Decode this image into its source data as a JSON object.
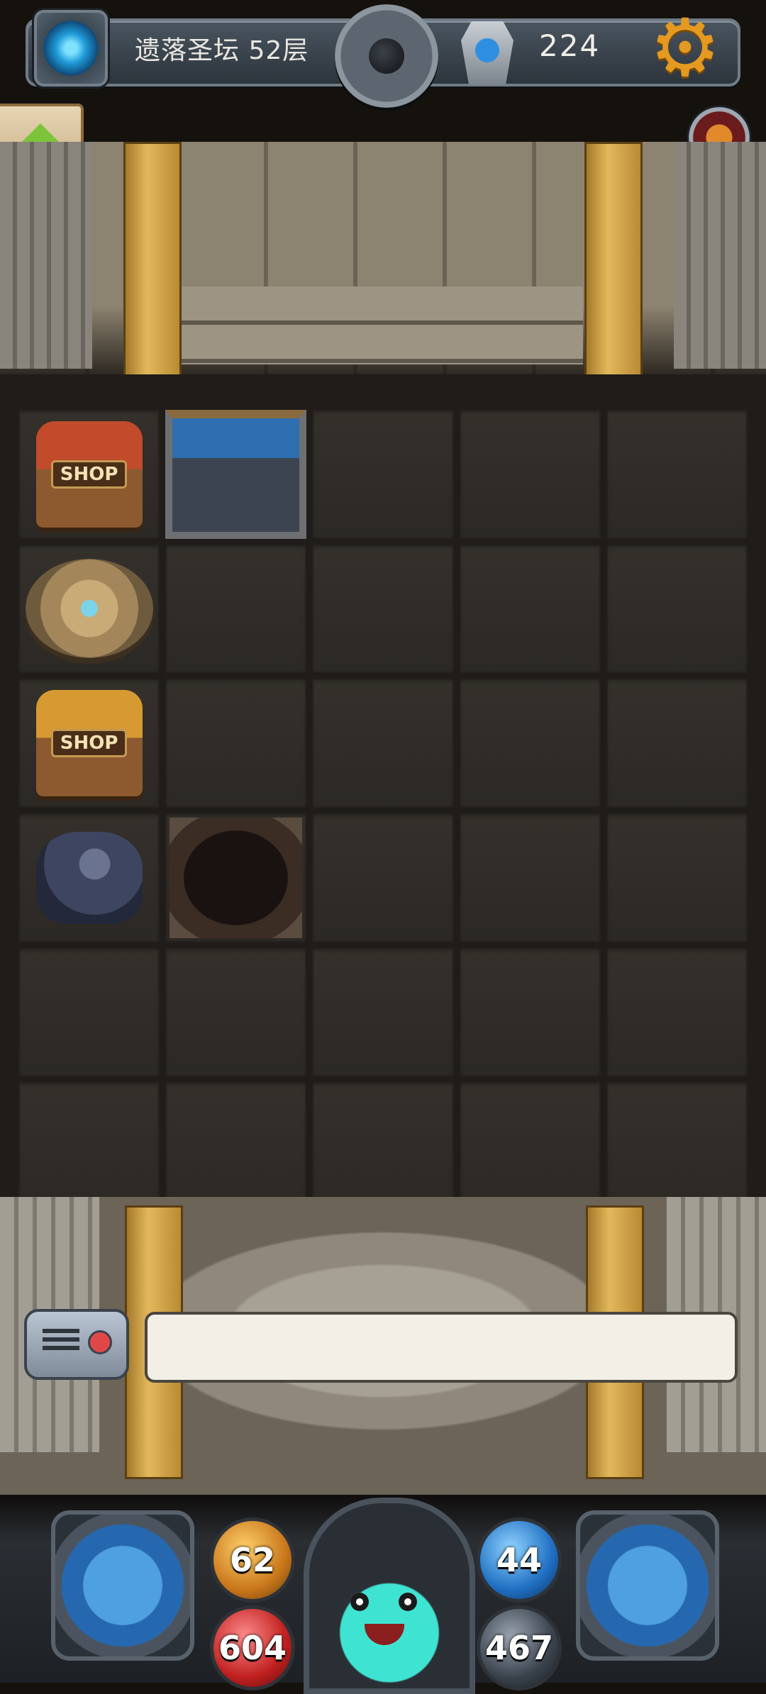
{
  "topbar": {
    "floor_label": "遗落圣坛 52层",
    "gem_count": "224",
    "settings_glyph": "⚙"
  },
  "icons": {
    "portal": "portal-icon",
    "center_medallion": "medallion-icon",
    "gem": "gem-icon",
    "settings": "gear-icon",
    "up": "up-arrow-icon",
    "monkey": "monkey-avatar-icon",
    "radio": "radio-icon"
  },
  "board": {
    "shop_sign_1": "SHOP",
    "shop_sign_2": "SHOP"
  },
  "message": {
    "text": ""
  },
  "stats": {
    "attack": "62",
    "defense": "44",
    "hp": "604",
    "mana": "467"
  },
  "colors": {
    "accent_gold": "#e49a20",
    "hp_red": "#c0201f",
    "defense_blue": "#1f6fc2"
  }
}
